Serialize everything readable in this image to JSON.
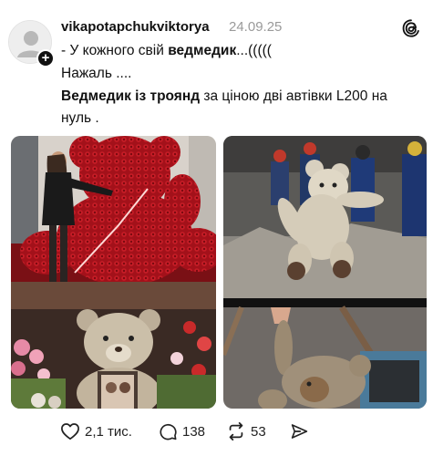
{
  "post": {
    "username": "vikapotapchukviktorya",
    "date": "24.09.25",
    "lines": {
      "l1_pre": "- У кожного свій ",
      "l1_bold": "ведмедик",
      "l1_post": "...(((((",
      "l2": "Нажаль ....",
      "l3_bold": "Ведмедик із троянд",
      "l3_post": " за ціною дві автівки L200 на",
      "l4": "нуль ."
    }
  },
  "actions": {
    "likes": "2,1 тис.",
    "comments": "138",
    "reposts": "53"
  },
  "icons": [
    "avatar-placeholder",
    "plus-icon",
    "threads-logo-icon",
    "heart-icon",
    "comment-icon",
    "repost-icon",
    "share-icon"
  ],
  "colors": {
    "text": "#111111",
    "muted": "#9a9a9a",
    "roses": "#b5141d"
  }
}
